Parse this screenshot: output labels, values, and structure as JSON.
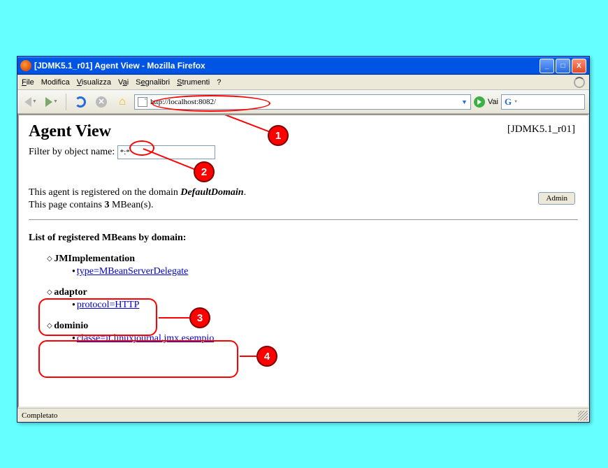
{
  "window": {
    "title": "[JDMK5.1_r01] Agent View - Mozilla Firefox"
  },
  "menu": {
    "file": "File",
    "edit": "Modifica",
    "view": "Visualizza",
    "go": "Vai",
    "bookmarks": "Segnalibri",
    "tools": "Strumenti",
    "help": "?"
  },
  "toolbar": {
    "url": "http://localhost:8082/",
    "go_label": "Vai"
  },
  "page": {
    "heading": "Agent View",
    "version": "[JDMK5.1_r01]",
    "filter_label": "Filter by object name:",
    "filter_value": "*:*",
    "domain_text_prefix": "This agent is registered on the domain ",
    "domain_name": "DefaultDomain",
    "domain_text_suffix": ".",
    "count_prefix": "This page contains ",
    "count": "3",
    "count_suffix": " MBean(s).",
    "admin_label": "Admin",
    "list_title": "List of registered MBeans by domain:",
    "domains": [
      {
        "name": "JMImplementation",
        "mbeans": [
          "type=MBeanServerDelegate"
        ]
      },
      {
        "name": "adaptor",
        "mbeans": [
          "protocol=HTTP"
        ]
      },
      {
        "name": "dominio",
        "mbeans": [
          "classe=it.linuxjournal.jmx.esempio"
        ]
      }
    ]
  },
  "status": {
    "text": "Completato"
  },
  "annotations": {
    "n1": "1",
    "n2": "2",
    "n3": "3",
    "n4": "4"
  }
}
